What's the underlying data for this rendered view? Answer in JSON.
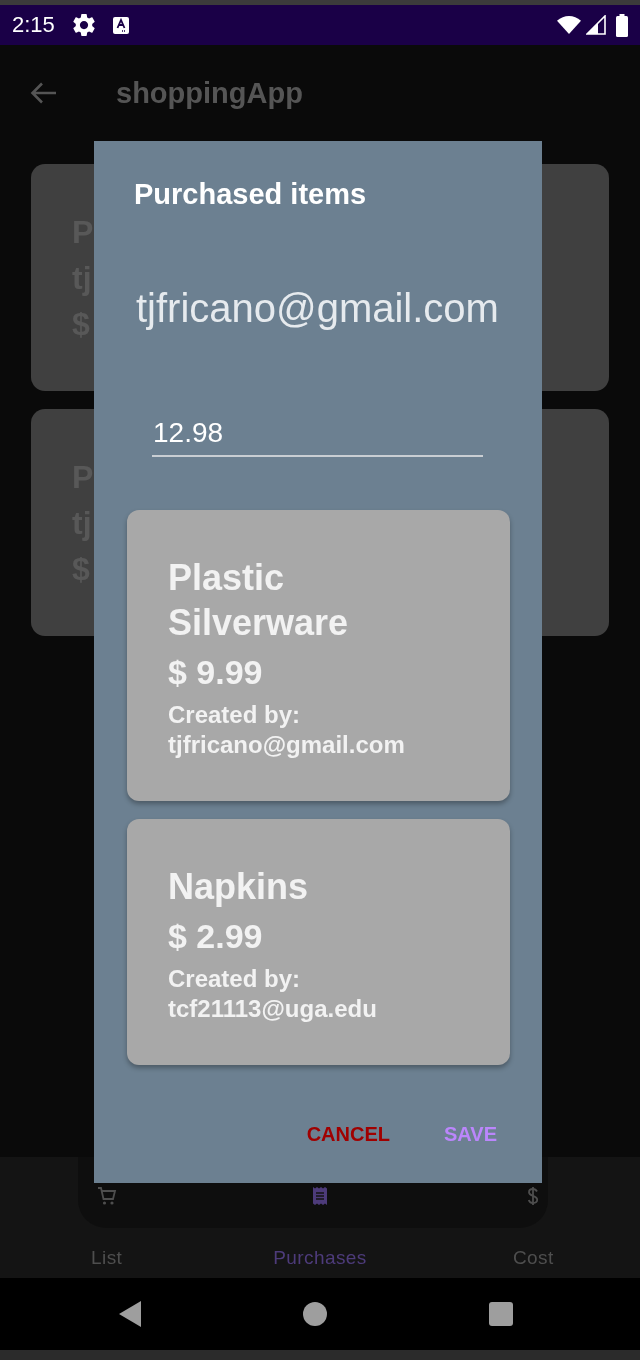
{
  "status_bar": {
    "time": "2:15"
  },
  "app_bar": {
    "title": "shoppingApp"
  },
  "background_cards": [
    {
      "line_1": "P",
      "line_2": "tj",
      "line_3": "$"
    },
    {
      "line_1": "P",
      "line_2": "tj",
      "line_3": "$"
    }
  ],
  "dialog": {
    "title": "Purchased items",
    "email": "tjfricano@gmail.com",
    "amount_field": {
      "value": "12.98"
    },
    "items": [
      {
        "name": "Plastic Silverware",
        "price": "$ 9.99",
        "created_by_label": "Created by:",
        "creator": "tjfricano@gmail.com"
      },
      {
        "name": "Napkins",
        "price": "$ 2.99",
        "created_by_label": "Created by:",
        "creator": "tcf21113@uga.edu"
      }
    ],
    "buttons": [
      {
        "label": "CANCEL",
        "kind": "cancel"
      },
      {
        "label": "SAVE",
        "kind": "save"
      }
    ]
  },
  "bottom_nav": {
    "tabs": [
      {
        "label": "List",
        "selected": false
      },
      {
        "label": "Purchases",
        "selected": true
      },
      {
        "label": "Cost",
        "selected": false
      }
    ]
  }
}
